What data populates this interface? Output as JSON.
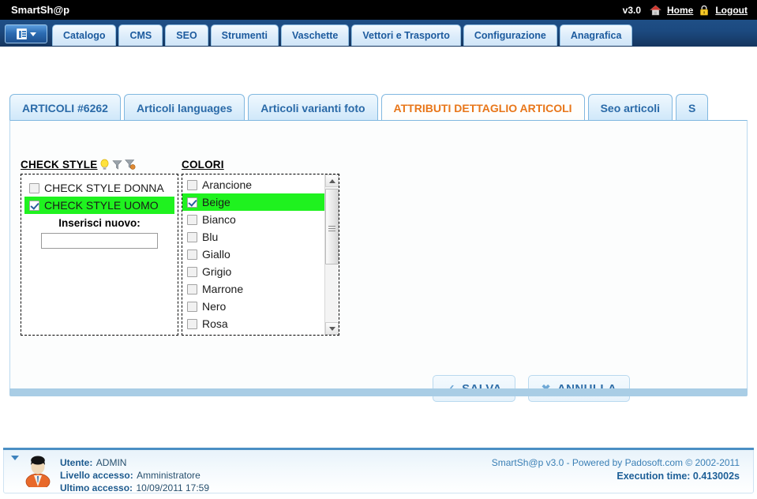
{
  "app": {
    "brand": "SmartSh@p",
    "version": "v3.0",
    "home_label": "Home",
    "logout_label": "Logout",
    "home_icon": "house-icon",
    "logout_icon": "padlock-icon",
    "menu_icon": "list-menu-icon"
  },
  "mainnav": {
    "items": [
      {
        "label": "Catalogo"
      },
      {
        "label": "CMS"
      },
      {
        "label": "SEO"
      },
      {
        "label": "Strumenti"
      },
      {
        "label": "Vaschette"
      },
      {
        "label": "Vettori e Trasporto"
      },
      {
        "label": "Configurazione"
      },
      {
        "label": "Anagrafica"
      }
    ]
  },
  "content_tabs": {
    "items": [
      {
        "label": "ARTICOLI #6262",
        "active": false
      },
      {
        "label": "Articoli languages",
        "active": false
      },
      {
        "label": "Articoli varianti foto",
        "active": false
      },
      {
        "label": "ATTRIBUTI DETTAGLIO ARTICOLI",
        "active": true
      },
      {
        "label": "Seo articoli",
        "active": false
      },
      {
        "label": "S",
        "active": false
      }
    ]
  },
  "check_style": {
    "title": "CHECK STYLE",
    "icons": [
      "lightbulb-icon",
      "filter-icon",
      "filter-clear-icon"
    ],
    "options": [
      {
        "label": "CHECK STYLE DONNA",
        "checked": false,
        "selected": false
      },
      {
        "label": "CHECK STYLE UOMO",
        "checked": true,
        "selected": true
      }
    ],
    "insert_label": "Inserisci nuovo:",
    "insert_value": "",
    "insert_placeholder": ""
  },
  "colori": {
    "title": "COLORI",
    "options": [
      {
        "label": "Arancione",
        "checked": false,
        "selected": false
      },
      {
        "label": "Beige",
        "checked": true,
        "selected": true
      },
      {
        "label": "Bianco",
        "checked": false,
        "selected": false
      },
      {
        "label": "Blu",
        "checked": false,
        "selected": false
      },
      {
        "label": "Giallo",
        "checked": false,
        "selected": false
      },
      {
        "label": "Grigio",
        "checked": false,
        "selected": false
      },
      {
        "label": "Marrone",
        "checked": false,
        "selected": false
      },
      {
        "label": "Nero",
        "checked": false,
        "selected": false
      },
      {
        "label": "Rosa",
        "checked": false,
        "selected": false
      }
    ]
  },
  "actions": {
    "save_label": "SALVA",
    "save_icon": "check-icon",
    "cancel_label": "ANNULLA",
    "cancel_icon": "cross-icon"
  },
  "footer": {
    "user_label": "Utente:",
    "user_value": "ADMIN",
    "level_label": "Livello accesso:",
    "level_value": "Amministratore",
    "last_label": "Ultimo accesso:",
    "last_value": "10/09/2011 17:59",
    "copyright": "SmartSh@p v3.0 - Powered by Padosoft.com © 2002-2011",
    "exec_time": "Execution time: 0.413002s",
    "avatar_icon": "user-avatar-icon",
    "collapse_icon": "triangle-down-icon"
  },
  "colors": {
    "accent_blue": "#1d5b9e",
    "active_tab_text": "#e8761a",
    "selected_row": "#1ff21f",
    "topbar": "#000000"
  }
}
